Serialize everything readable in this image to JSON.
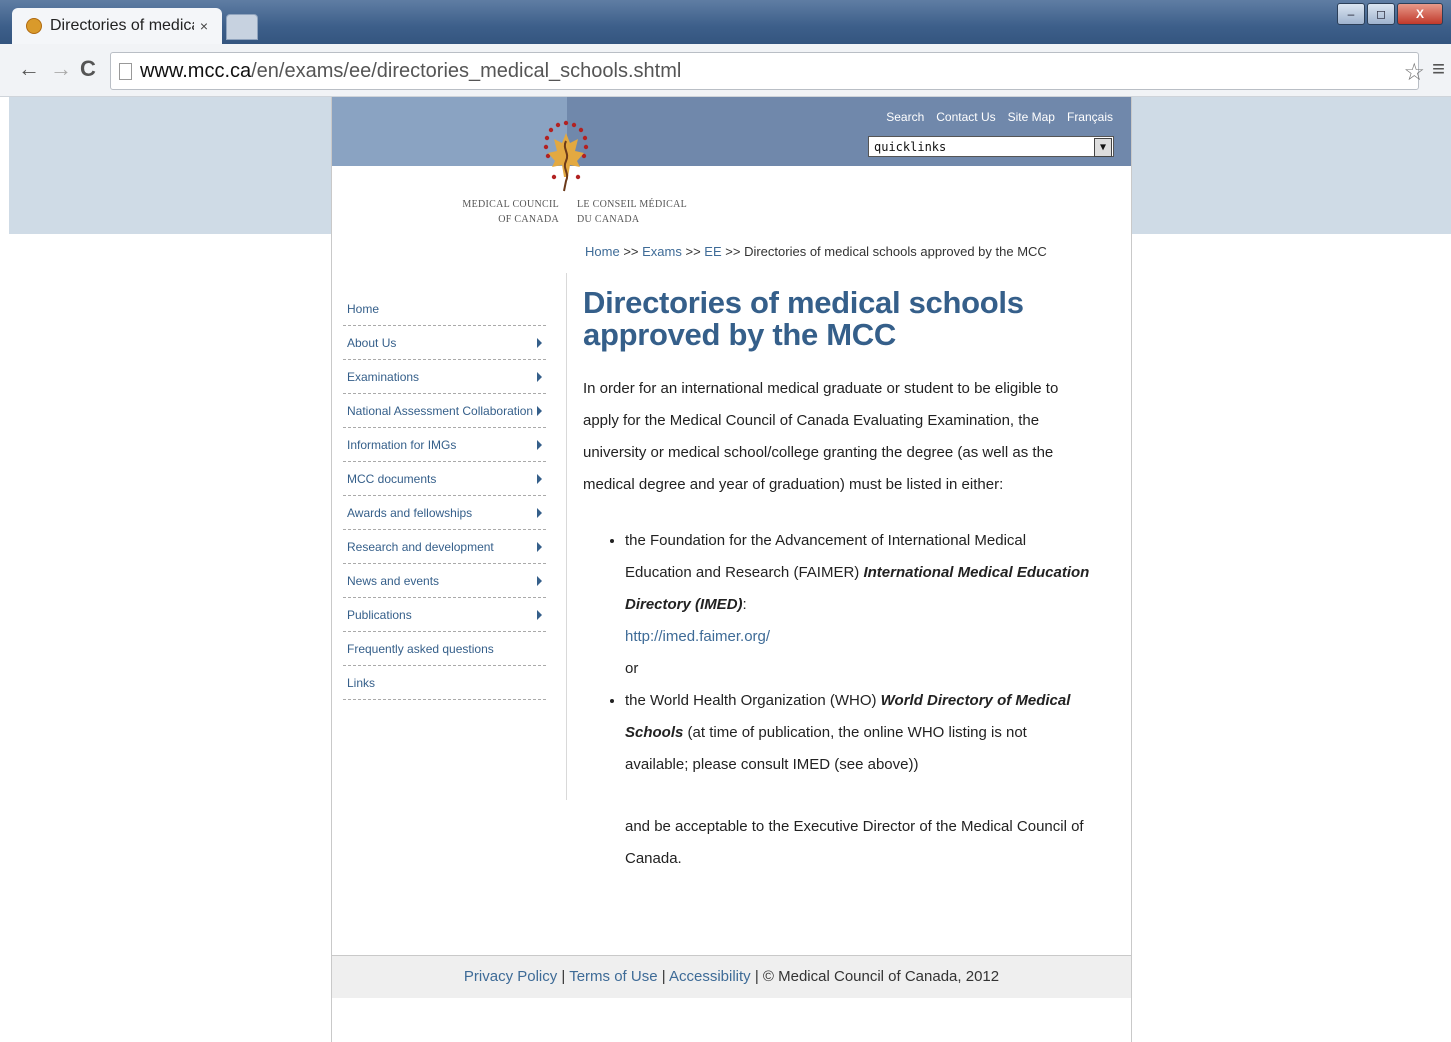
{
  "browser": {
    "tab_title": "Directories of medical sch",
    "tab_close": "×",
    "url_domain": "www.mcc.ca",
    "url_path": "/en/exams/ee/directories_medical_schools.shtml",
    "minimize": "–",
    "maximize": "◻",
    "close": "X"
  },
  "header": {
    "utility_links": [
      "Search",
      "Contact Us",
      "Site Map",
      "Français"
    ],
    "quicklinks": "quicklinks",
    "logo_text_en": [
      "MEDICAL COUNCIL",
      "OF CANADA"
    ],
    "logo_text_fr": [
      "LE CONSEIL MÉDICAL",
      "DU CANADA"
    ]
  },
  "breadcrumb": {
    "items": [
      "Home",
      "Exams",
      "EE"
    ],
    "separator": ">>",
    "current": "Directories of medical schools approved by the MCC"
  },
  "nav": {
    "items": [
      {
        "label": "Home",
        "arrow": false
      },
      {
        "label": "About Us",
        "arrow": true
      },
      {
        "label": "Examinations",
        "arrow": true
      },
      {
        "label": "National Assessment Collaboration",
        "arrow": true
      },
      {
        "label": "Information for IMGs",
        "arrow": true
      },
      {
        "label": "MCC documents",
        "arrow": true
      },
      {
        "label": "Awards and fellowships",
        "arrow": true
      },
      {
        "label": "Research and development",
        "arrow": true
      },
      {
        "label": "News and events",
        "arrow": true
      },
      {
        "label": "Publications",
        "arrow": true
      },
      {
        "label": "Frequently asked questions",
        "arrow": false
      },
      {
        "label": "Links",
        "arrow": false
      }
    ]
  },
  "content": {
    "title": "Directories of medical schools approved by the MCC",
    "intro": "In order for an international medical graduate or student to be eligible to apply for the Medical Council of Canada Evaluating Examination, the university or medical school/college granting the degree (as well as the medical degree and year of graduation) must be listed in either:",
    "item1_prefix": "the Foundation for the Advancement of International Medical Education and Research (FAIMER) ",
    "item1_emph": "International Medical Education Directory (IMED)",
    "item1_suffix": ":",
    "item1_link": "http://imed.faimer.org/",
    "or": "or",
    "item2_prefix": "the World Health Organization (WHO) ",
    "item2_emph": "World Directory of Medical Schools",
    "item2_suffix": " (at time of publication, the online WHO listing is not available; please consult IMED (see above))",
    "closing": "and be acceptable to the Executive Director of the Medical Council of Canada."
  },
  "footer": {
    "links": [
      "Privacy Policy",
      "Terms of Use",
      "Accessibility"
    ],
    "copyright": "© Medical Council of Canada, 2012"
  }
}
